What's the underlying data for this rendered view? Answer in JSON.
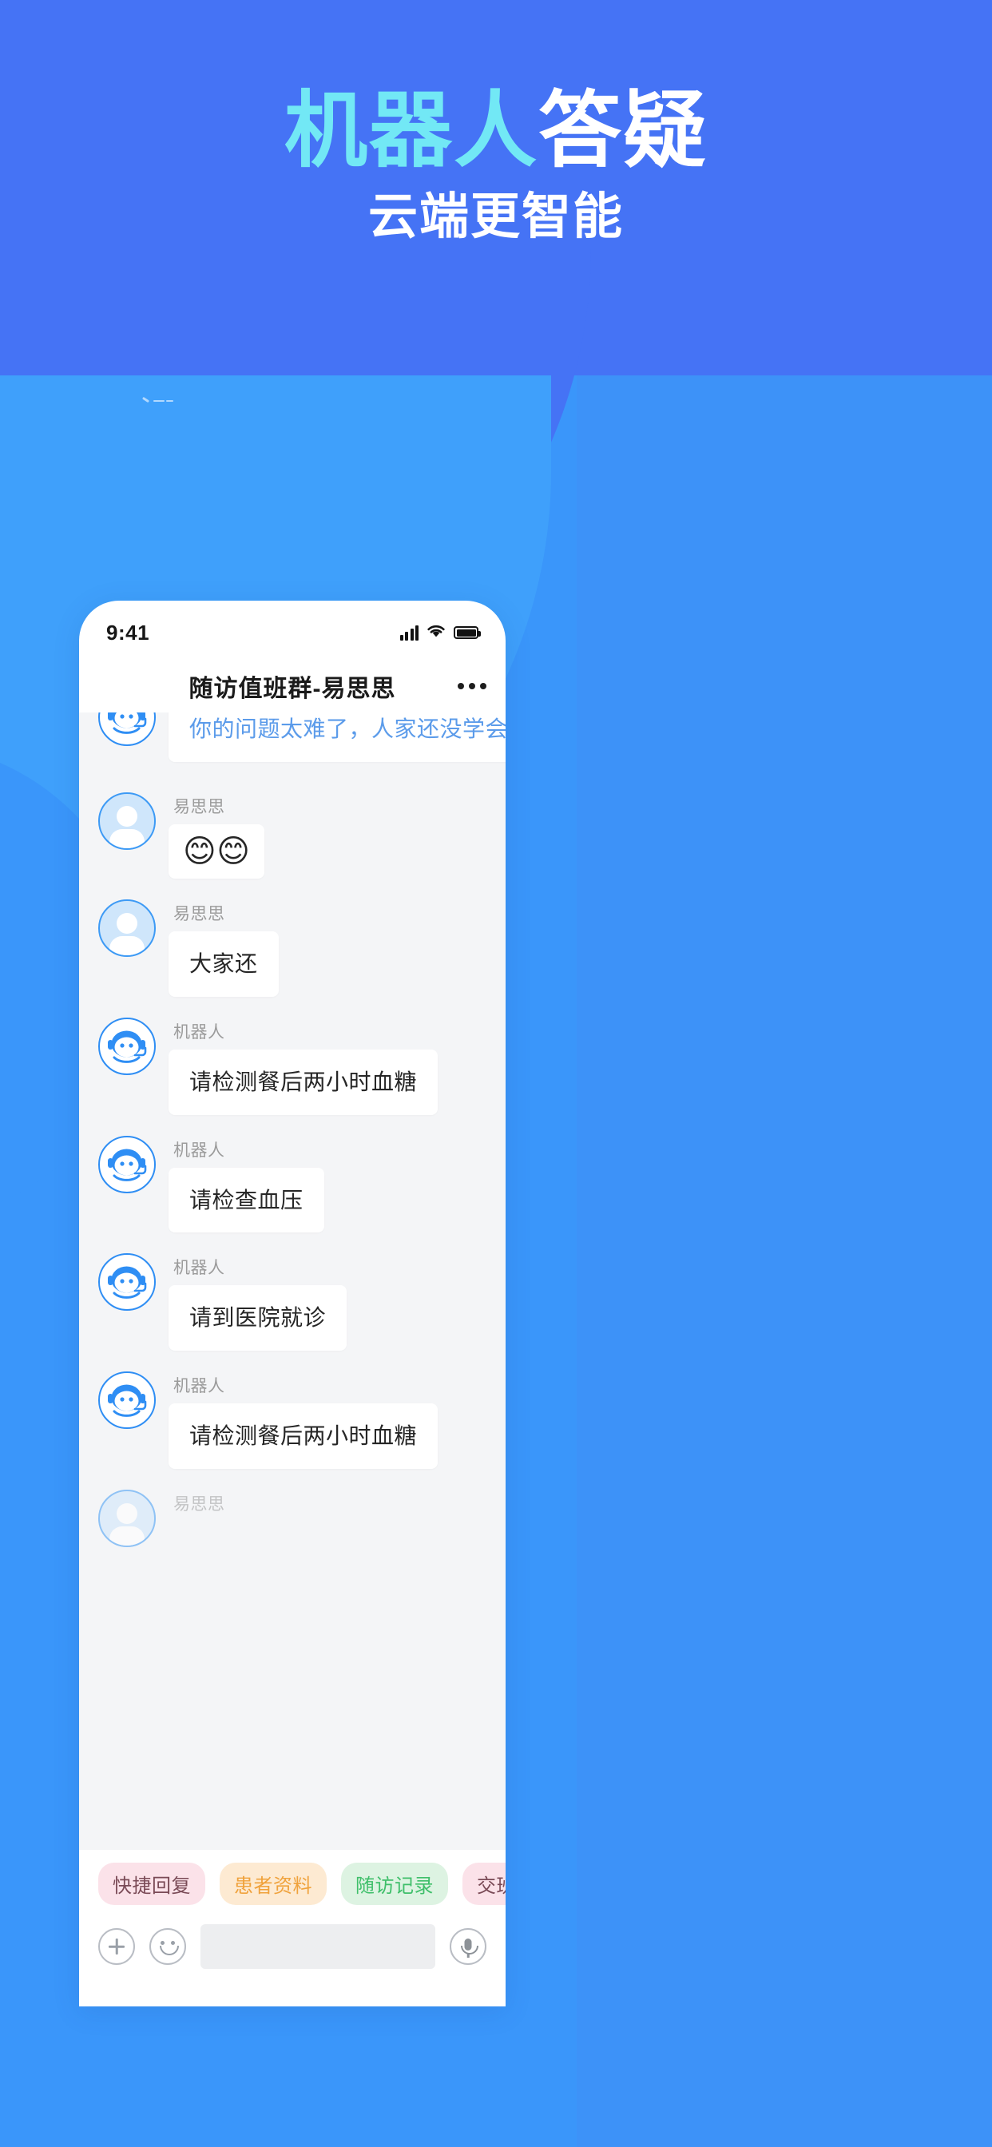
{
  "poster": {
    "headline_part1": "机器人",
    "headline_part2": "答疑",
    "subheadline": "云端更智能",
    "colors": {
      "background_blue": "#4573F5",
      "background_blue_light": "#3A96FA",
      "background_blue_lighter": "#3FA0FB",
      "headline_cyan": "#72E8F5",
      "headline_white": "#FFFFFF"
    }
  },
  "phone": {
    "statusbar": {
      "time": "9:41",
      "signal_icon": "cellular-signal-icon",
      "wifi_icon": "wifi-icon",
      "battery_icon": "battery-full-icon"
    },
    "navbar": {
      "title": "随访值班群-易思思",
      "more_icon": "more-dots-icon"
    },
    "chat": {
      "messages": [
        {
          "sender": "",
          "avatar": "robot-avatar",
          "text": "你的问题太难了，人家还没学会~!!~",
          "style": "accent"
        },
        {
          "sender": "易思思",
          "avatar": "person-avatar",
          "text": "😊😊",
          "style": "emoji"
        },
        {
          "sender": "易思思",
          "avatar": "person-avatar",
          "text": "大家还",
          "style": "plain"
        },
        {
          "sender": "机器人",
          "avatar": "robot-avatar",
          "text": "请检测餐后两小时血糖",
          "style": "plain"
        },
        {
          "sender": "机器人",
          "avatar": "robot-avatar",
          "text": "请检查血压",
          "style": "plain"
        },
        {
          "sender": "机器人",
          "avatar": "robot-avatar",
          "text": "请到医院就诊",
          "style": "plain"
        },
        {
          "sender": "机器人",
          "avatar": "robot-avatar",
          "text": "请检测餐后两小时血糖",
          "style": "plain"
        },
        {
          "sender": "易思思",
          "avatar": "person-avatar",
          "text": "",
          "style": "plain"
        }
      ]
    },
    "chips": [
      {
        "label": "快捷回复",
        "color": "pink"
      },
      {
        "label": "患者资料",
        "color": "orange"
      },
      {
        "label": "随访记录",
        "color": "green"
      },
      {
        "label": "交班",
        "color": "pink"
      }
    ],
    "inputbar": {
      "plus_icon": "plus-circle-icon",
      "emoji_icon": "smiley-face-icon",
      "mic_icon": "microphone-icon",
      "input_value": "",
      "input_placeholder": ""
    }
  }
}
